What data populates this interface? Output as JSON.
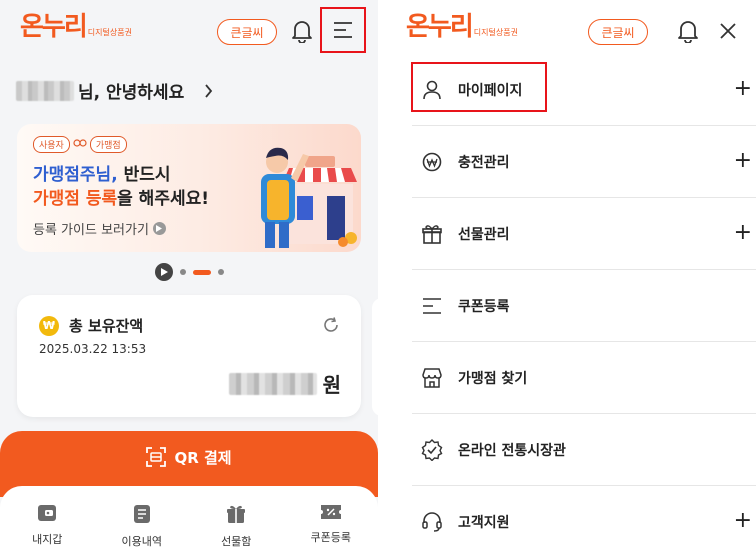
{
  "colors": {
    "accent": "#f25a1f",
    "highlight": "#e8141a",
    "coin": "#f2b90c"
  },
  "left_screen": {
    "logo": {
      "main": "온누리",
      "sub": "디지털상품권"
    },
    "header": {
      "bigfont_label": "큰글씨",
      "bell_icon": "bell-icon",
      "menu_icon": "hamburger-menu-icon"
    },
    "greeting": "님, 안녕하세요",
    "banner": {
      "tag_user": "사용자",
      "tag_store": "가맹점",
      "line1_highlight": "가맹점주님,",
      "line1_rest": " 반드시",
      "line2_highlight": "가맹점 등록",
      "line2_rest": "을 해주세요!",
      "guide_link": "등록 가이드 보러가기"
    },
    "carousel": {
      "page_count": 3,
      "active_index": 1
    },
    "balance": {
      "title": "총 보유잔액",
      "coin_symbol": "₩",
      "date": "2025.03.22 13:53",
      "currency_unit": "원"
    },
    "qr_payment": "QR 결제",
    "bottom_nav": [
      {
        "label": "내지갑",
        "icon": "wallet-icon"
      },
      {
        "label": "이용내역",
        "icon": "receipt-icon"
      },
      {
        "label": "선물함",
        "icon": "gift-box-icon"
      },
      {
        "label": "쿠폰등록",
        "icon": "coupon-icon"
      }
    ]
  },
  "right_screen": {
    "logo": {
      "main": "온누리",
      "sub": "디지털상품권"
    },
    "header": {
      "bigfont_label": "큰글씨",
      "bell_icon": "bell-icon",
      "close_icon": "close-icon"
    },
    "menu": [
      {
        "label": "마이페이지",
        "icon": "user-icon",
        "expandable": true
      },
      {
        "label": "충전관리",
        "icon": "won-coin-icon",
        "expandable": true
      },
      {
        "label": "선물관리",
        "icon": "gift-icon",
        "expandable": true
      },
      {
        "label": "쿠폰등록",
        "icon": "coupon-list-icon",
        "expandable": false
      },
      {
        "label": "가맹점 찾기",
        "icon": "store-icon",
        "expandable": false
      },
      {
        "label": "온라인 전통시장관",
        "icon": "badge-check-icon",
        "expandable": false
      },
      {
        "label": "고객지원",
        "icon": "headset-icon",
        "expandable": true
      }
    ]
  }
}
